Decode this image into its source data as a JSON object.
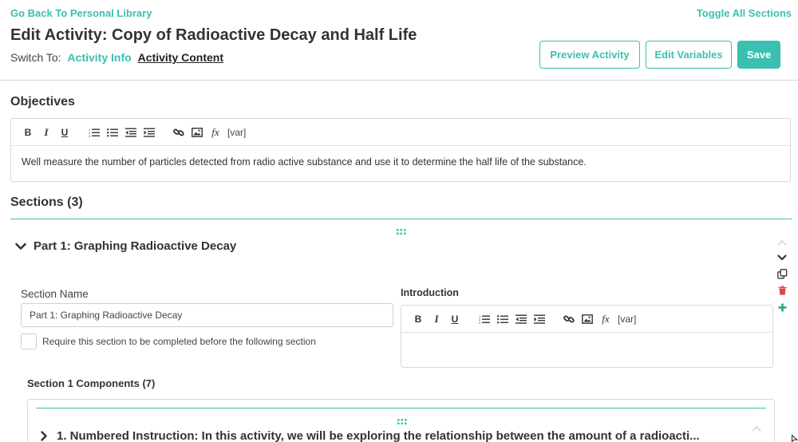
{
  "header": {
    "back_link": "Go Back To Personal Library",
    "toggle_all": "Toggle All Sections",
    "title": "Edit Activity: Copy of Radioactive Decay and Half Life",
    "switch_to_label": "Switch To:",
    "switch_links": [
      "Activity Info",
      "Activity Content"
    ],
    "active_switch": "Activity Content",
    "buttons": {
      "preview": "Preview Activity",
      "variables": "Edit Variables",
      "save": "Save"
    }
  },
  "toolbar": {
    "bold": "B",
    "italic": "I",
    "underline": "U",
    "fx": "fx",
    "var": "[var]",
    "icons": [
      "ordered-list-icon",
      "bullet-list-icon",
      "outdent-icon",
      "indent-icon",
      "link-icon",
      "image-icon"
    ]
  },
  "objectives": {
    "heading": "Objectives",
    "text": "Well measure the number of particles detected from radio active substance and use it to determine the half life of the substance."
  },
  "sections": {
    "heading": "Sections (3)",
    "part1": {
      "title": "Part 1: Graphing Radioactive Decay",
      "name_label": "Section Name",
      "name_value": "Part 1: Graphing Radioactive Decay",
      "require_label": "Require this section to be completed before the following section",
      "require_checked": false,
      "intro_label": "Introduction",
      "intro_text": "",
      "components_label": "Section 1 Components (7)",
      "components": [
        {
          "title": "1. Numbered Instruction: In this activity, we will be exploring the relationship between the amount of a radioacti..."
        }
      ]
    }
  },
  "colors": {
    "accent": "#3bbfb0",
    "delete": "#e04848",
    "add": "#2aa58f",
    "border": "#d8d8d8"
  }
}
